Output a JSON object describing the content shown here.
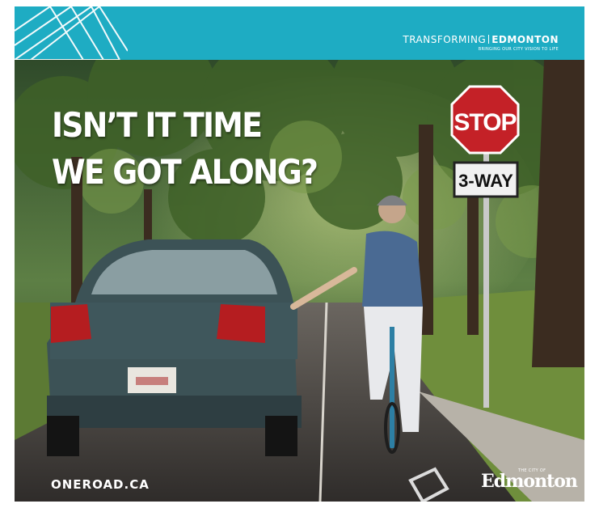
{
  "banner": {
    "color": "#1eacc3",
    "brand_left": "TRANSFORMING",
    "brand_right": "EDMONTON",
    "tagline": "BRINGING OUR CITY VISION TO LIFE"
  },
  "headline": {
    "line1": "ISN’T IT TIME",
    "line2": "WE GOT ALONG?"
  },
  "signs": {
    "stop": "STOP",
    "way": "3-WAY"
  },
  "footer": {
    "url": "ONEROAD.CA",
    "logo_small": "THE CITY OF",
    "logo_word": "Edmonton"
  }
}
